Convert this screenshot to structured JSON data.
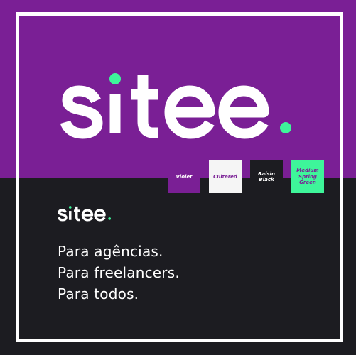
{
  "colors": {
    "violet": "#7A1F95",
    "cultured": "#F5F5F5",
    "raisin_black": "#1C1C21",
    "medium_spring_green": "#3EF59A",
    "white": "#FFFFFF"
  },
  "brand": {
    "logo_text": "sitee."
  },
  "palette": [
    {
      "name": "Violet",
      "color": "#7A1F95",
      "text_color": "#FFFFFF"
    },
    {
      "name": "Cultered",
      "color": "#F5F5F5",
      "text_color": "#7A1F95"
    },
    {
      "name": "Raisin Black",
      "color": "#1C1C21",
      "text_color": "#FFFFFF"
    },
    {
      "name": "Medium Spring Green",
      "color": "#3EF59A",
      "text_color": "#7A1F95"
    }
  ],
  "taglines": [
    "Para agências.",
    "Para freelancers.",
    "Para todos."
  ]
}
